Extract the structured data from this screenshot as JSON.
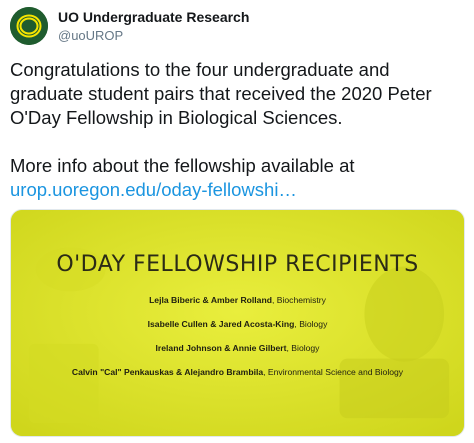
{
  "account": {
    "display_name": "UO Undergraduate Research",
    "handle": "@uoUROP",
    "avatar_letter": "O"
  },
  "tweet": {
    "text_line_1": "Congratulations to the four undergraduate and graduate student pairs that received the 2020 Peter O'Day Fellowship in Biological Sciences.",
    "text_line_2": "More info about the fellowship available at",
    "link": "urop.uoregon.edu/oday-fellowshi…"
  },
  "card": {
    "title": "O'DAY FELLOWSHIP RECIPIENTS",
    "recipients": [
      {
        "pair": "Lejla Biberic & Amber Rolland",
        "field": "Biochemistry"
      },
      {
        "pair": "Isabelle Cullen & Jared Acosta-King",
        "field": "Biology"
      },
      {
        "pair": "Ireland Johnson & Annie Gilbert",
        "field": "Biology"
      },
      {
        "pair": "Calvin \"Cal\" Penkauskas & Alejandro Brambila",
        "field": "Environmental Science and Biology"
      }
    ]
  },
  "colors": {
    "avatar_bg": "#1f5c2e",
    "avatar_letter": "#f7e500",
    "link": "#1b95e0",
    "card_bg": "#e2e82c"
  },
  "icons": {
    "avatar": "oregon-o-logo-icon"
  }
}
